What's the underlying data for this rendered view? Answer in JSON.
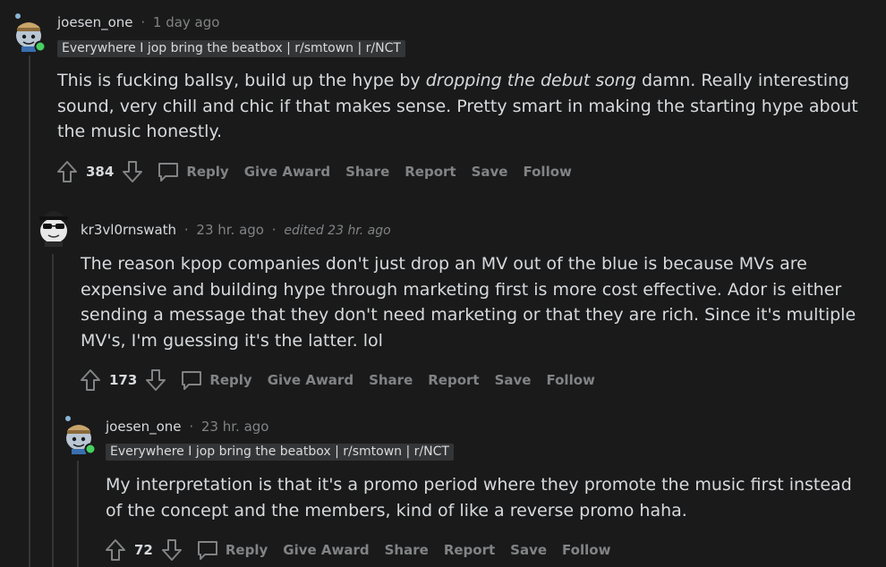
{
  "comments": [
    {
      "username": "joesen_one",
      "sep": "·",
      "time": "1 day ago",
      "flair": "Everywhere I jop bring the beatbox | r/smtown | r/NCT",
      "body_before": "This is fucking ballsy, build up the hype by ",
      "body_italic": "dropping the debut song",
      "body_after": " damn. Really interesting sound, very chill and chic if that makes sense. Pretty smart in making the starting hype about the music honestly.",
      "votes": "384",
      "actions": {
        "reply": "Reply",
        "award": "Give Award",
        "share": "Share",
        "report": "Report",
        "save": "Save",
        "follow": "Follow"
      }
    },
    {
      "username": "kr3vl0rnswath",
      "sep": "·",
      "time": "23 hr. ago",
      "sep2": "·",
      "edited": "edited 23 hr. ago",
      "body": "The reason kpop companies don't just drop an MV out of the blue is because MVs are expensive and building hype through marketing first is more cost effective. Ador is either sending a message that they don't need marketing or that they are rich. Since it's multiple MV's, I'm guessing it's the latter. lol",
      "votes": "173",
      "actions": {
        "reply": "Reply",
        "award": "Give Award",
        "share": "Share",
        "report": "Report",
        "save": "Save",
        "follow": "Follow"
      }
    },
    {
      "username": "joesen_one",
      "sep": "·",
      "time": "23 hr. ago",
      "flair": "Everywhere I jop bring the beatbox | r/smtown | r/NCT",
      "body": "My interpretation is that it's a promo period where they promote the music first instead of the concept and the members, kind of like a reverse promo haha.",
      "votes": "72",
      "actions": {
        "reply": "Reply",
        "award": "Give Award",
        "share": "Share",
        "report": "Report",
        "save": "Save",
        "follow": "Follow"
      }
    }
  ]
}
